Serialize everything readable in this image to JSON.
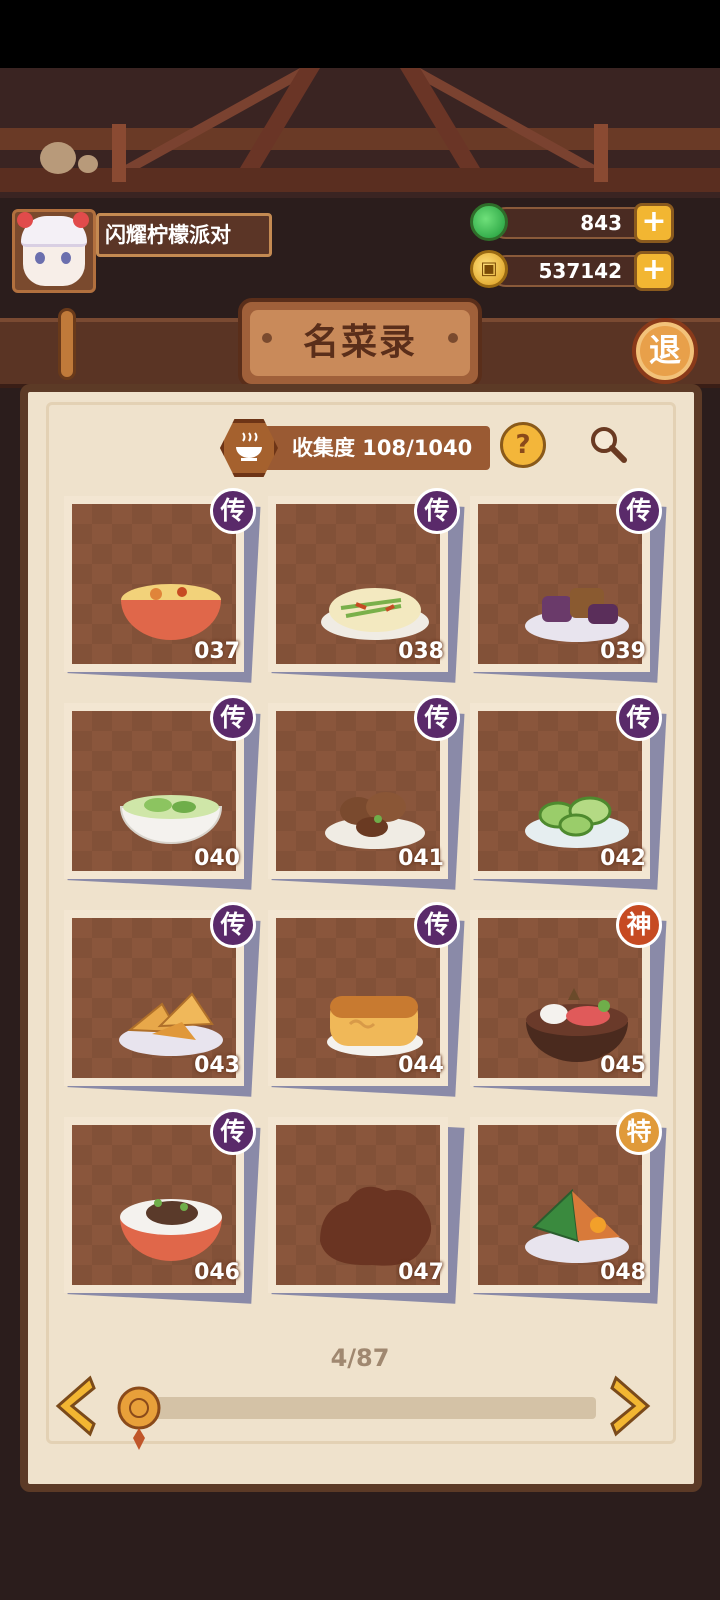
{
  "player": {
    "name": "闪耀柠檬派对"
  },
  "currencies": [
    {
      "icon": "jade-icon",
      "value": "843"
    },
    {
      "icon": "coin-icon",
      "value": "537142"
    }
  ],
  "header": {
    "title": "名菜录",
    "exit_label": "退"
  },
  "collection": {
    "label": "收集度 108/1040",
    "help": "?"
  },
  "cards": [
    {
      "number": "037",
      "rarity": "传",
      "dish": "soup-bowl"
    },
    {
      "number": "038",
      "rarity": "传",
      "dish": "noodle-plate"
    },
    {
      "number": "039",
      "rarity": "传",
      "dish": "eggplant-plate"
    },
    {
      "number": "040",
      "rarity": "传",
      "dish": "green-soup"
    },
    {
      "number": "041",
      "rarity": "传",
      "dish": "mushroom-plate"
    },
    {
      "number": "042",
      "rarity": "传",
      "dish": "cucumber-plate"
    },
    {
      "number": "043",
      "rarity": "传",
      "dish": "fried-pastry"
    },
    {
      "number": "044",
      "rarity": "传",
      "dish": "bread-loaf"
    },
    {
      "number": "045",
      "rarity": "神",
      "dish": "hotpot"
    },
    {
      "number": "046",
      "rarity": "传",
      "dish": "rice-bowl"
    },
    {
      "number": "047",
      "rarity": "",
      "dish": "locked-silhouette"
    },
    {
      "number": "048",
      "rarity": "特",
      "dish": "zongzi"
    }
  ],
  "pager": {
    "text": "4/87",
    "current": 4,
    "total": 87
  },
  "colors": {
    "legend": "#5a2a6a",
    "god": "#c64a22",
    "special": "#e09a3a",
    "card_bg": "#8a563c"
  }
}
